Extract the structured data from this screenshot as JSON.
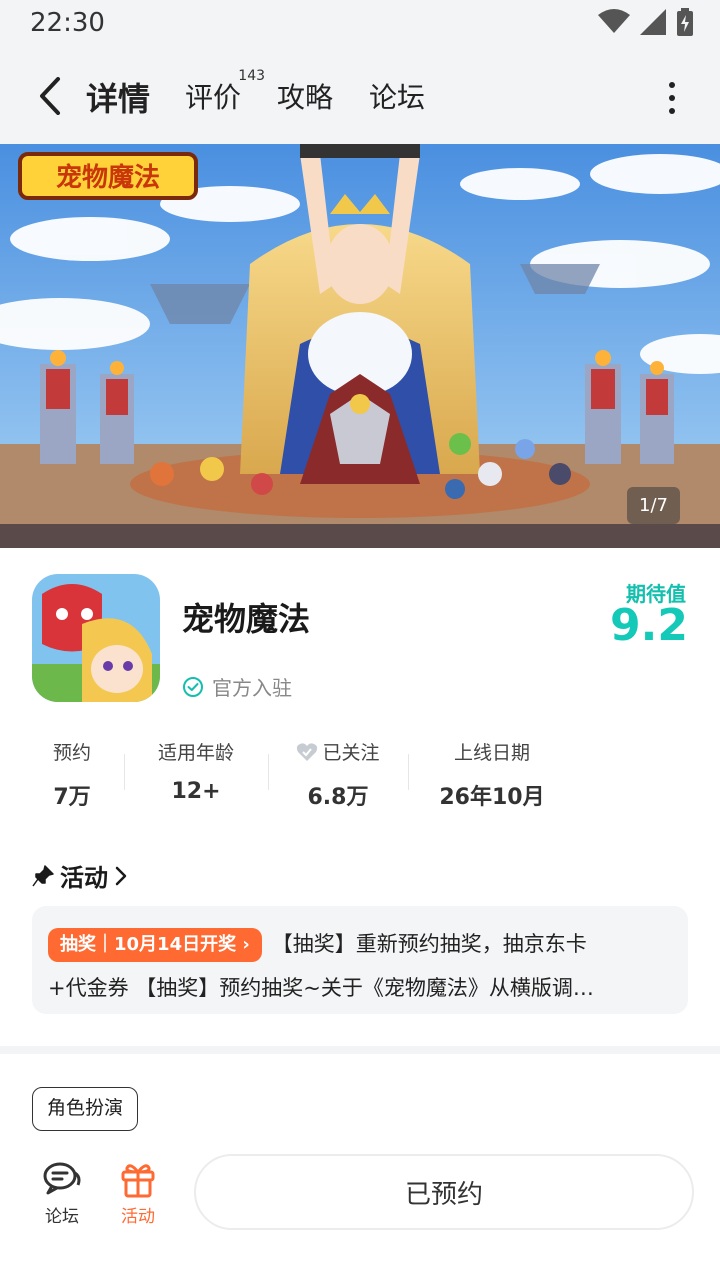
{
  "status_bar": {
    "time": "22:30"
  },
  "nav": {
    "tabs": [
      {
        "label": "详情",
        "active": true
      },
      {
        "label": "评价",
        "badge": "143"
      },
      {
        "label": "攻略"
      },
      {
        "label": "论坛"
      }
    ]
  },
  "banner": {
    "logo_text": "宠物魔法",
    "counter": "1/7"
  },
  "app": {
    "name": "宠物魔法",
    "official": "官方入驻",
    "score_label": "期待值",
    "score": "9.2"
  },
  "stats": [
    {
      "label": "预约",
      "value": "7万"
    },
    {
      "label": "适用年龄",
      "value": "12+"
    },
    {
      "label": "已关注",
      "value": "6.8万"
    },
    {
      "label": "上线日期",
      "value": "26年10月"
    }
  ],
  "activity": {
    "title": "活动",
    "tag": "抽奖｜10月14日开奖",
    "line1": "【抽奖】重新预约抽奖，抽京东卡",
    "line2": "+代金券 【抽奖】预约抽奖~关于《宠物魔法》从横版调…"
  },
  "genre_tag": "角色扮演",
  "bottom": {
    "forum_label": "论坛",
    "activity_label": "活动",
    "reserve_label": "已预约"
  },
  "colors": {
    "accent": "#14cfbd",
    "orange": "#ff6a33"
  }
}
